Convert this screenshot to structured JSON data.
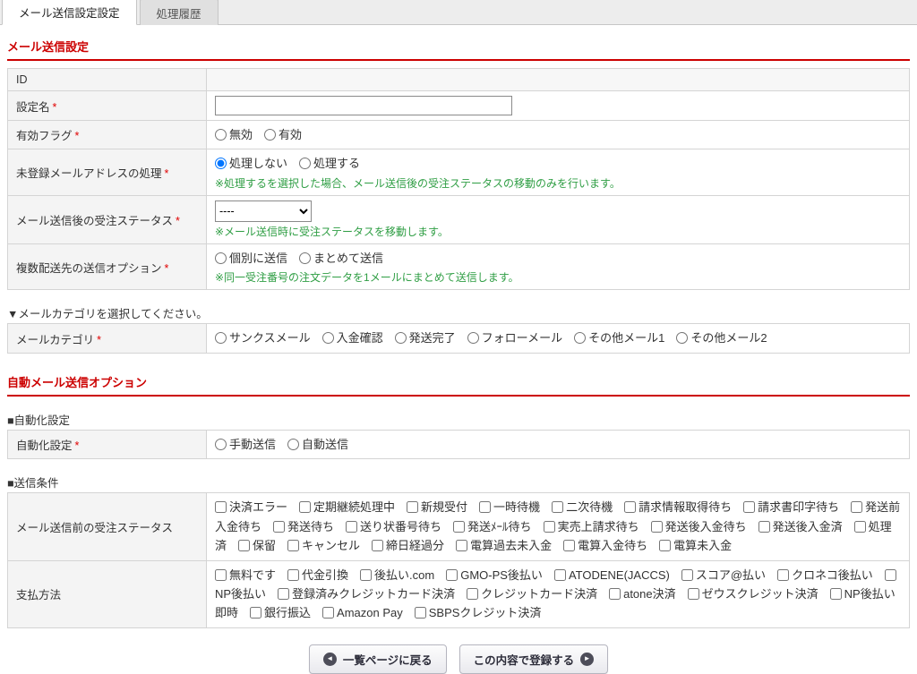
{
  "tabs": [
    {
      "label": "メール送信設定設定",
      "active": true
    },
    {
      "label": "処理履歴",
      "active": false
    }
  ],
  "headings": {
    "mail_settings": "メール送信設定",
    "auto_options": "自動メール送信オプション"
  },
  "subheaders": {
    "category": "▼メールカテゴリを選択してください。",
    "automation": "■自動化設定",
    "conditions": "■送信条件"
  },
  "required_mark": "*",
  "form": {
    "id": {
      "label": "ID",
      "value": ""
    },
    "setting_name": {
      "label": "設定名"
    },
    "enabled_flag": {
      "label": "有効フラグ",
      "options": [
        "無効",
        "有効"
      ]
    },
    "unregistered": {
      "label": "未登録メールアドレスの処理",
      "options": [
        {
          "label": "処理しない",
          "checked": true
        },
        "処理する"
      ],
      "note": "※処理するを選択した場合、メール送信後の受注ステータスの移動のみを行います。"
    },
    "post_status": {
      "label": "メール送信後の受注ステータス",
      "selected": "----",
      "note": "※メール送信時に受注ステータスを移動します。"
    },
    "multi_ship": {
      "label": "複数配送先の送信オプション",
      "options": [
        "個別に送信",
        "まとめて送信"
      ],
      "note": "※同一受注番号の注文データを1メールにまとめて送信します。"
    },
    "mail_category": {
      "label": "メールカテゴリ",
      "options": [
        "サンクスメール",
        "入金確認",
        "発送完了",
        "フォローメール",
        "その他メール1",
        "その他メール2"
      ]
    },
    "automation": {
      "label": "自動化設定",
      "options": [
        "手動送信",
        "自動送信"
      ]
    },
    "pre_status": {
      "label": "メール送信前の受注ステータス",
      "options": [
        "決済エラー",
        "定期継続処理中",
        "新規受付",
        "一時待機",
        "二次待機",
        "請求情報取得待ち",
        "請求書印字待ち",
        "発送前入金待ち",
        "発送待ち",
        "送り状番号待ち",
        "発送ﾒｰﾙ待ち",
        "実売上請求待ち",
        "発送後入金待ち",
        "発送後入金済",
        "処理済",
        "保留",
        "キャンセル",
        "締日経過分",
        "電算過去未入金",
        "電算入金待ち",
        "電算未入金"
      ]
    },
    "payment": {
      "label": "支払方法",
      "options": [
        "無料です",
        "代金引換",
        "後払い.com",
        "GMO-PS後払い",
        "ATODENE(JACCS)",
        "スコア@払い",
        "クロネコ後払い",
        "NP後払い",
        "登録済みクレジットカード決済",
        "クレジットカード決済",
        "atone決済",
        "ゼウスクレジット決済",
        "NP後払い即時",
        "銀行振込",
        "Amazon Pay",
        "SBPSクレジット決済"
      ]
    }
  },
  "buttons": {
    "back": "一覧ページに戻る",
    "submit": "この内容で登録する",
    "back_icon": "◄",
    "submit_icon": "►"
  },
  "colors": {
    "accent_red": "#cc0000",
    "note_green": "#2f9e44"
  }
}
